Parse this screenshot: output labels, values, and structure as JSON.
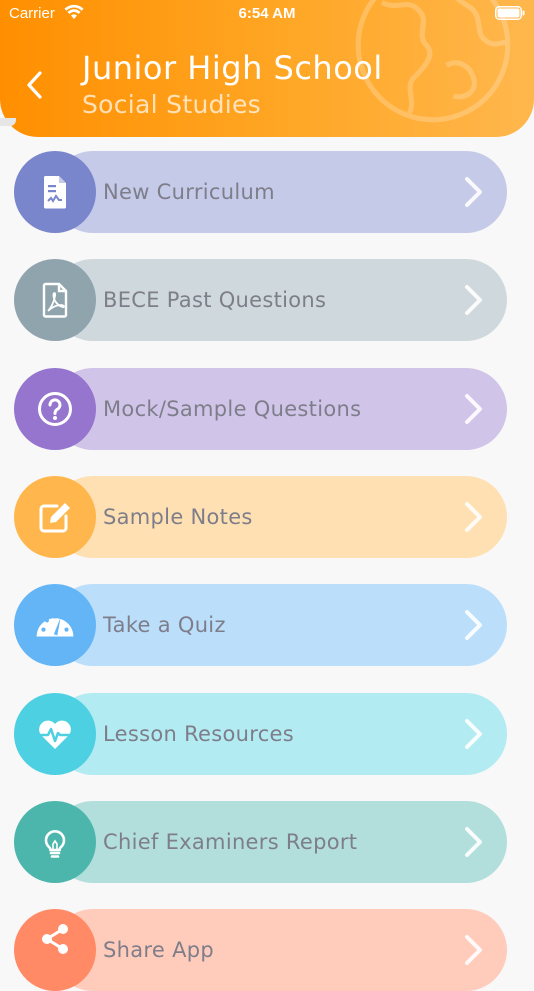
{
  "status_bar": {
    "carrier": "Carrier",
    "time": "6:54 AM"
  },
  "header": {
    "title": "Junior High School",
    "subtitle": "Social Studies"
  },
  "menu": {
    "items": [
      {
        "label": "New Curriculum",
        "icon": "document-icon",
        "circle_color": "#7986cb",
        "pill_color": "#c5cae9"
      },
      {
        "label": "BECE Past Questions",
        "icon": "pdf-icon",
        "circle_color": "#90a4ae",
        "pill_color": "#cfd8dc"
      },
      {
        "label": "Mock/Sample Questions",
        "icon": "question-icon",
        "circle_color": "#9575cd",
        "pill_color": "#d1c4e9"
      },
      {
        "label": "Sample Notes",
        "icon": "edit-note-icon",
        "circle_color": "#ffb74d",
        "pill_color": "#ffe0b2"
      },
      {
        "label": "Take a Quiz",
        "icon": "speedometer-icon",
        "circle_color": "#64b5f6",
        "pill_color": "#bbdefb"
      },
      {
        "label": "Lesson Resources",
        "icon": "heartbeat-icon",
        "circle_color": "#4dd0e1",
        "pill_color": "#b2ebf2"
      },
      {
        "label": "Chief Examiners Report",
        "icon": "lightbulb-icon",
        "circle_color": "#4db6ac",
        "pill_color": "#b2dfdb"
      },
      {
        "label": "Share App",
        "icon": "share-icon",
        "circle_color": "#ff8a65",
        "pill_color": "#ffccbc"
      }
    ]
  }
}
